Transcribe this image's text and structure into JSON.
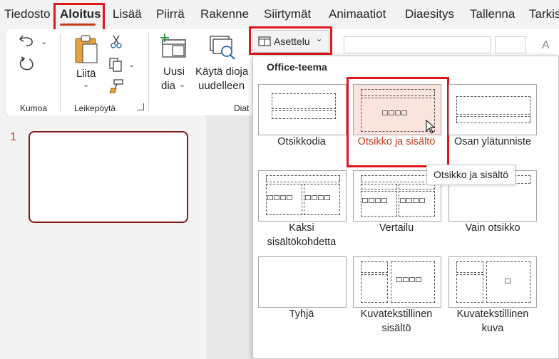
{
  "tabs": [
    "Tiedosto",
    "Aloitus",
    "Lisää",
    "Piirrä",
    "Rakenne",
    "Siirtymät",
    "Animaatiot",
    "Diaesitys",
    "Tallenna",
    "Tarkis"
  ],
  "active_tab": "Aloitus",
  "ribbon": {
    "undo_group": "Kumoa",
    "clipboard_group": "Leikepöytä",
    "paste_label": "Liitä",
    "new_slide_label": "Uusi",
    "new_slide_label2": "dia",
    "reuse_label": "Käytä dioja",
    "reuse_label2": "uudelleen",
    "slides_group": "Diat",
    "layout_button": "Asettelu"
  },
  "slide_number": "1",
  "dropdown": {
    "title": "Office-teema",
    "layouts": [
      {
        "label": "Otsikkodia"
      },
      {
        "label": "Otsikko ja sisältö"
      },
      {
        "label": "Osan ylätunniste"
      },
      {
        "label": "Kaksi sisältökohdetta"
      },
      {
        "label": "Vertailu"
      },
      {
        "label": "Vain otsikko"
      },
      {
        "label": "Tyhjä"
      },
      {
        "label": "Kuvatekstillinen sisältö"
      },
      {
        "label": "Kuvatekstillinen kuva"
      }
    ],
    "tooltip": "Otsikko ja sisältö"
  },
  "colors": {
    "accent": "#c43e1c",
    "highlight": "#e0161b",
    "hover_bg": "#fbe3de"
  }
}
